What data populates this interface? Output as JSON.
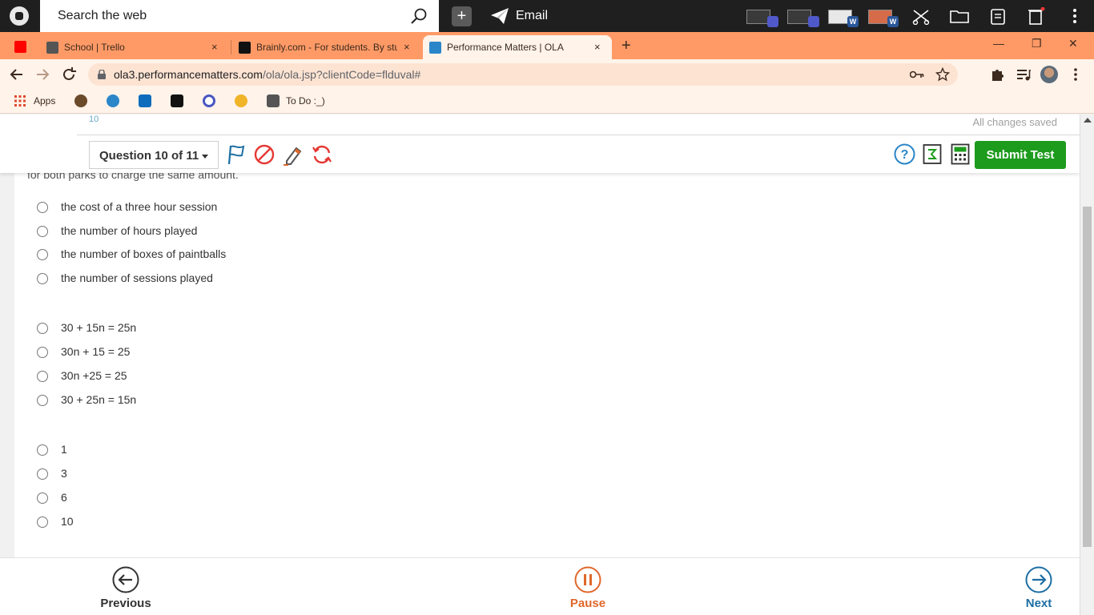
{
  "os_bar": {
    "search_placeholder": "Search the web",
    "add_label": "+",
    "email_label": "Email",
    "word_badge": "W"
  },
  "tabs": [
    {
      "title": "School | Trello",
      "close": "×"
    },
    {
      "title": "Brainly.com - For students. By stu",
      "close": "×"
    },
    {
      "title": "Performance Matters | OLA",
      "close": "×",
      "active": true
    }
  ],
  "tabstrip": {
    "new_tab": "+",
    "minimize": "—",
    "restore": "❐",
    "close": "✕"
  },
  "address_bar": {
    "url_host": "ola3.performancematters.com",
    "url_path": "/ola/ola.jsp?clientCode=flduval#"
  },
  "bookmarks": [
    {
      "label": "Apps"
    },
    {
      "label": "To Do :_)"
    }
  ],
  "test_header": {
    "fragment": "10",
    "saved_status": "All changes saved",
    "question_selector": "Question 10 of 11",
    "submit_label": "Submit Test",
    "help_glyph": "?"
  },
  "question": {
    "tail_text": "for both parks to charge the same amount.",
    "groups": [
      {
        "options": [
          "the cost of a three hour session",
          "the number of hours played",
          "the number of boxes of paintballs",
          "the number of sessions played"
        ]
      },
      {
        "options": [
          "30 + 15n = 25n",
          "30n + 15 = 25",
          "30n +25 = 25",
          "30 + 25n = 15n"
        ]
      },
      {
        "options": [
          "1",
          "3",
          "6",
          "10"
        ]
      }
    ]
  },
  "footer": {
    "previous": "Previous",
    "pause": "Pause",
    "next": "Next"
  },
  "colors": {
    "tabstrip": "#ff9a66",
    "submit": "#1d9b1d",
    "pause": "#e0672a",
    "nav": "#1c6ea4"
  }
}
